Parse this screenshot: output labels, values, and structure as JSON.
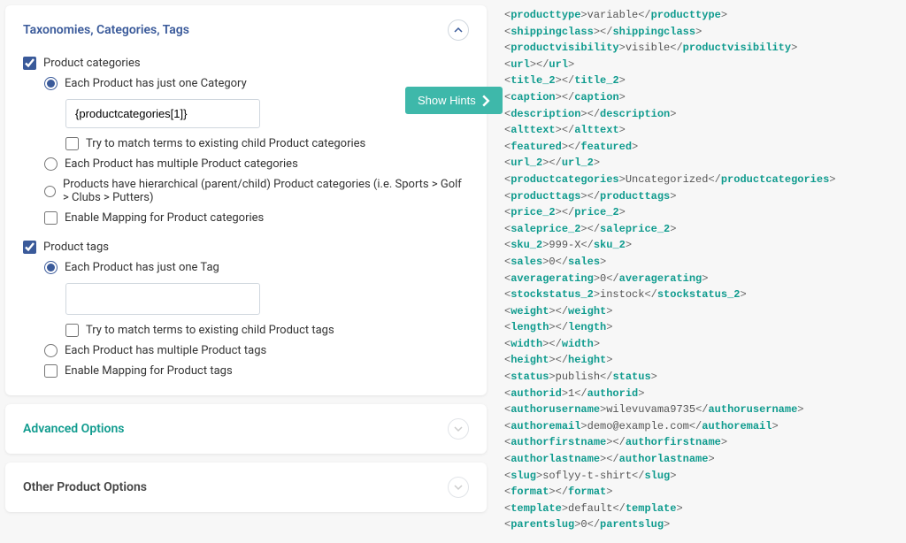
{
  "taxonomies": {
    "title": "Taxonomies, Categories, Tags",
    "show_hints": "Show Hints",
    "product_categories": {
      "label": "Product categories",
      "checked": true,
      "opts": {
        "one": "Each Product has just one Category",
        "value": "{productcategories[1]}",
        "match_child": "Try to match terms to existing child Product categories",
        "multiple": "Each Product has multiple Product categories",
        "hierarchical": "Products have hierarchical (parent/child) Product categories (i.e. Sports > Golf > Clubs > Putters)",
        "mapping": "Enable Mapping for Product categories"
      }
    },
    "product_tags": {
      "label": "Product tags",
      "checked": true,
      "opts": {
        "one": "Each Product has just one Tag",
        "match_child": "Try to match terms to existing child Product tags",
        "multiple": "Each Product has multiple Product tags",
        "mapping": "Enable Mapping for Product tags"
      }
    }
  },
  "advanced_options": {
    "title": "Advanced Options"
  },
  "other_product_options": {
    "title": "Other Product Options"
  },
  "xml": [
    {
      "tag": "producttype",
      "val": "variable"
    },
    {
      "tag": "shippingclass",
      "val": ""
    },
    {
      "tag": "productvisibility",
      "val": "visible"
    },
    {
      "tag": "url",
      "val": ""
    },
    {
      "tag": "title_2",
      "val": ""
    },
    {
      "tag": "caption",
      "val": ""
    },
    {
      "tag": "description",
      "val": ""
    },
    {
      "tag": "alttext",
      "val": ""
    },
    {
      "tag": "featured",
      "val": ""
    },
    {
      "tag": "url_2",
      "val": ""
    },
    {
      "tag": "productcategories",
      "val": "Uncategorized"
    },
    {
      "tag": "producttags",
      "val": ""
    },
    {
      "tag": "price_2",
      "val": ""
    },
    {
      "tag": "saleprice_2",
      "val": ""
    },
    {
      "tag": "sku_2",
      "val": "999-X"
    },
    {
      "tag": "sales",
      "val": "0"
    },
    {
      "tag": "averagerating",
      "val": "0"
    },
    {
      "tag": "stockstatus_2",
      "val": "instock"
    },
    {
      "tag": "weight",
      "val": ""
    },
    {
      "tag": "length",
      "val": ""
    },
    {
      "tag": "width",
      "val": ""
    },
    {
      "tag": "height",
      "val": ""
    },
    {
      "tag": "status",
      "val": "publish"
    },
    {
      "tag": "authorid",
      "val": "1"
    },
    {
      "tag": "authorusername",
      "val": "wilevuvama9735"
    },
    {
      "tag": "authoremail",
      "val": "demo@example.com"
    },
    {
      "tag": "authorfirstname",
      "val": ""
    },
    {
      "tag": "authorlastname",
      "val": ""
    },
    {
      "tag": "slug",
      "val": "soflyy-t-shirt"
    },
    {
      "tag": "format",
      "val": ""
    },
    {
      "tag": "template",
      "val": "default"
    },
    {
      "tag": "parentslug",
      "val": "0"
    }
  ]
}
